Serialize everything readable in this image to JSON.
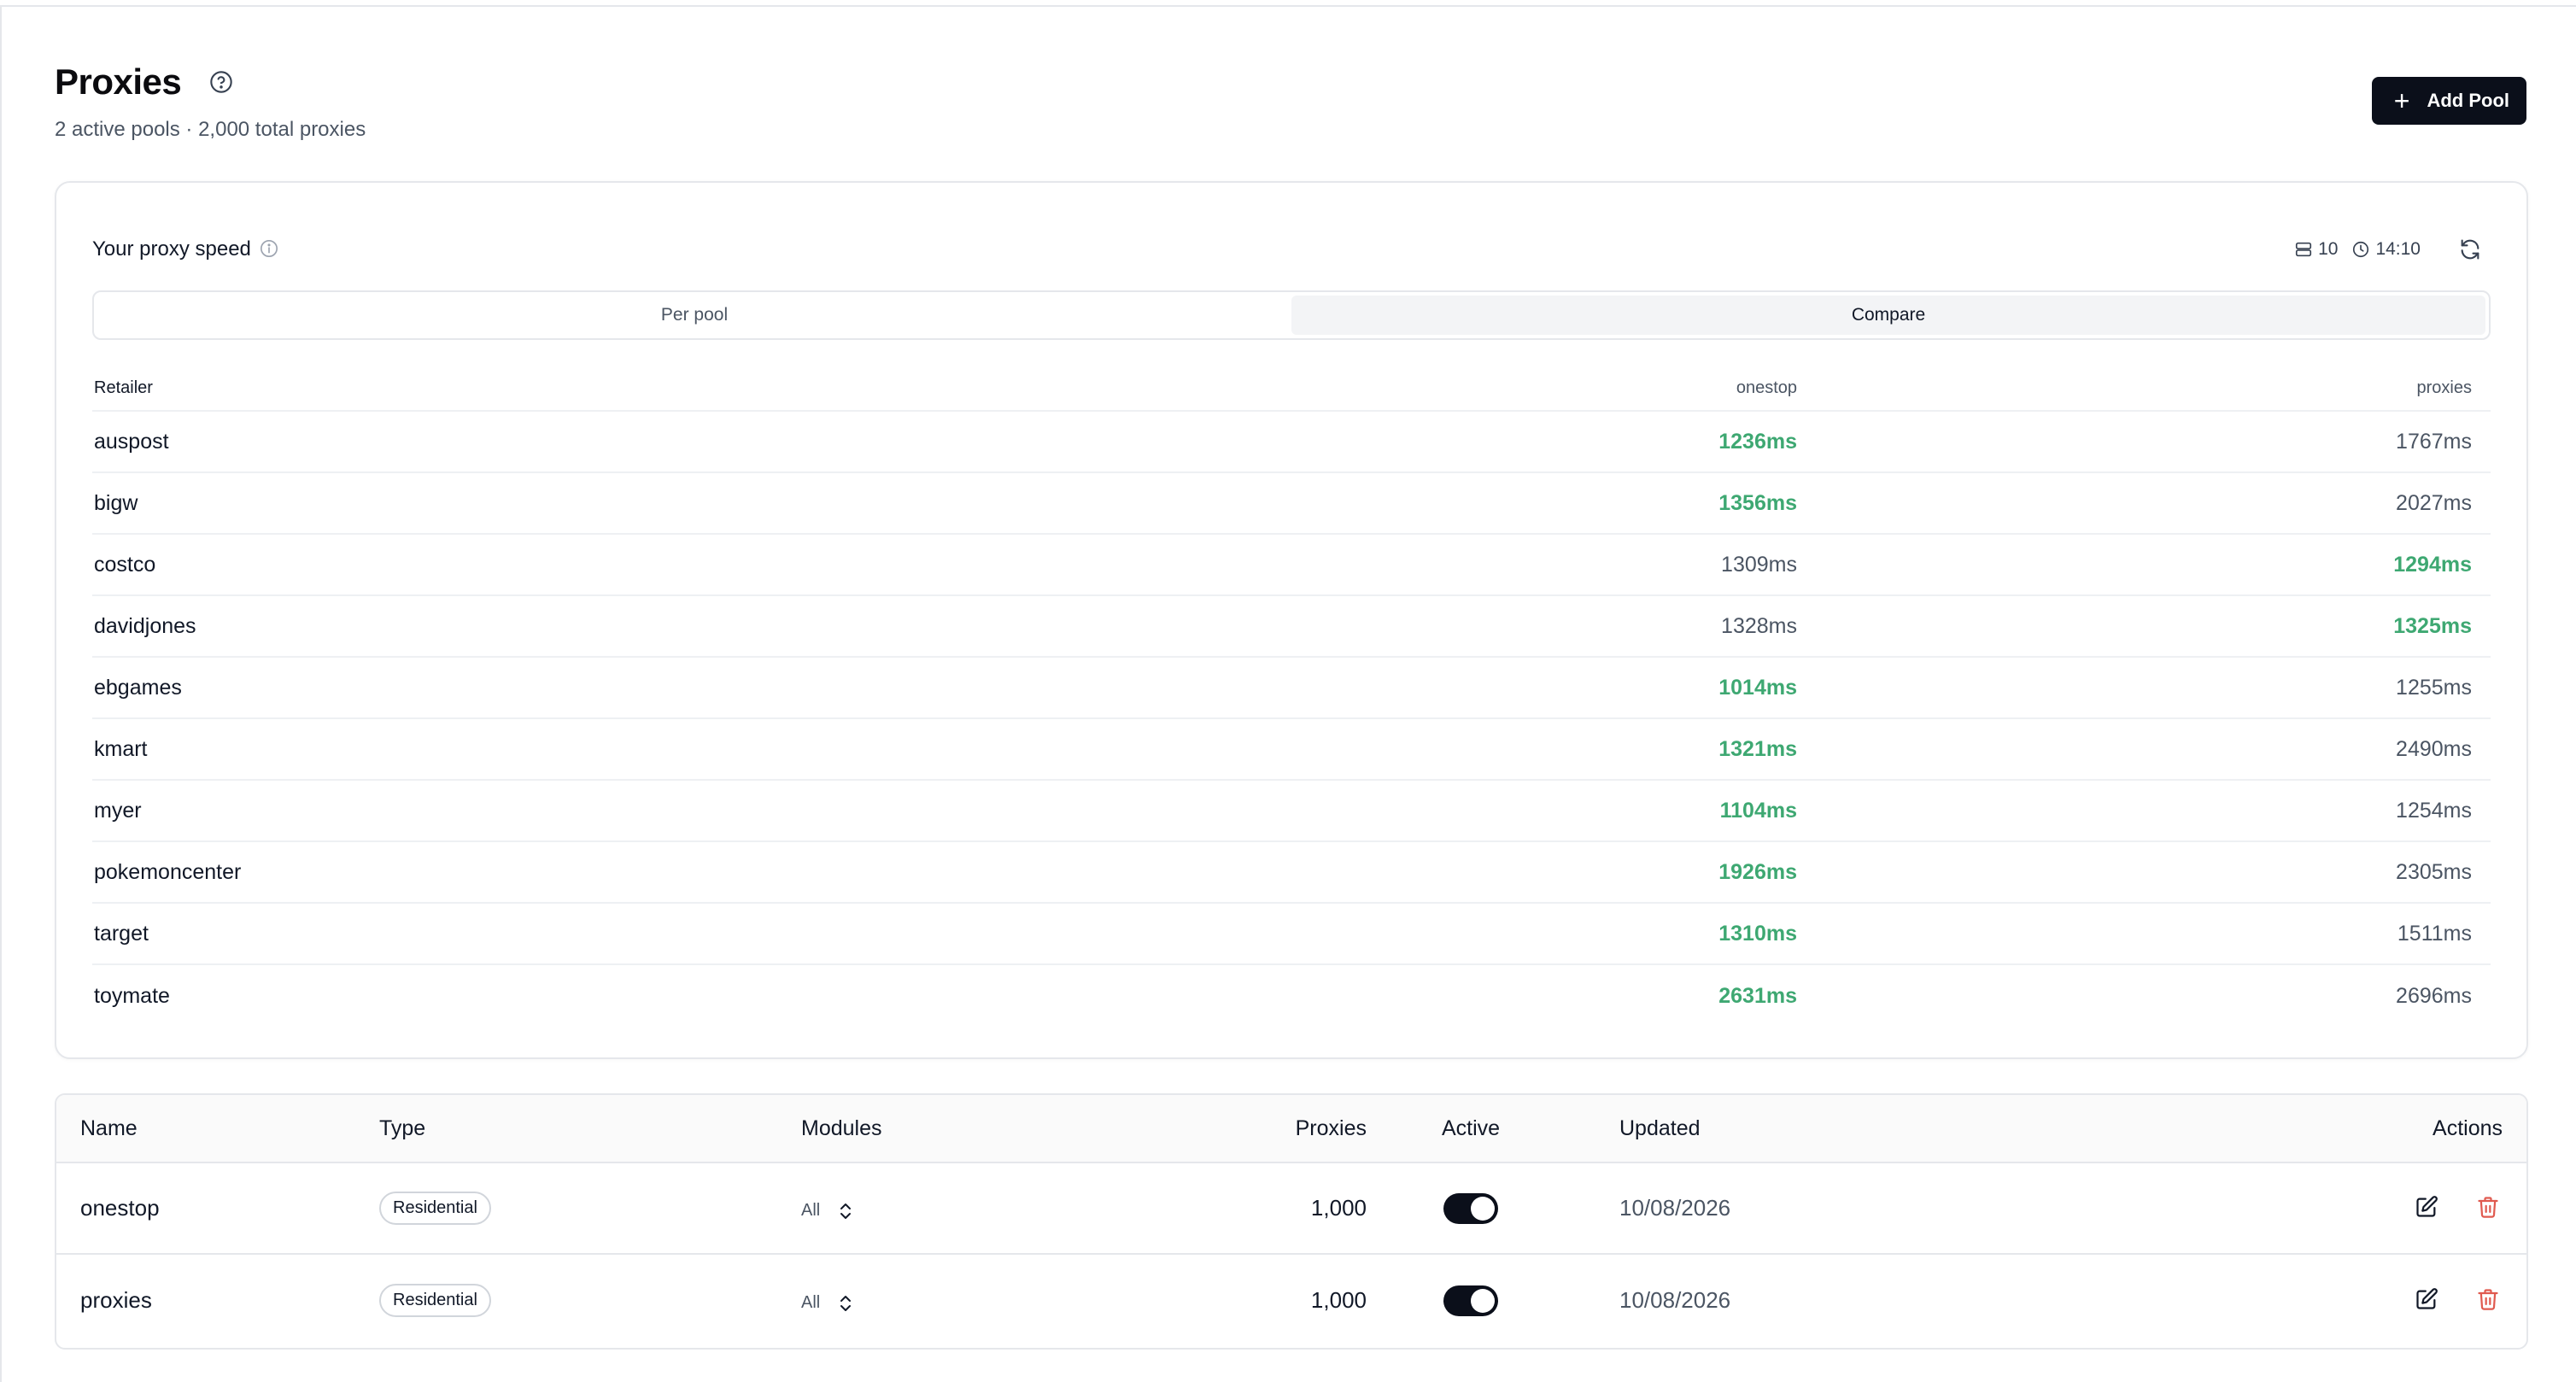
{
  "header": {
    "title": "Proxies",
    "subtitle": "2 active pools · 2,000 total proxies",
    "add_button_label": "Add Pool"
  },
  "speed": {
    "title": "Your proxy speed",
    "meta_count": "10",
    "meta_time": "14:10",
    "tabs": [
      {
        "label": "Per pool",
        "active": false
      },
      {
        "label": "Compare",
        "active": true
      }
    ],
    "columns": [
      "Retailer",
      "onestop",
      "proxies"
    ],
    "rows": [
      {
        "retailer": "auspost",
        "onestop": "1236ms",
        "proxies": "1767ms",
        "best": "onestop"
      },
      {
        "retailer": "bigw",
        "onestop": "1356ms",
        "proxies": "2027ms",
        "best": "onestop"
      },
      {
        "retailer": "costco",
        "onestop": "1309ms",
        "proxies": "1294ms",
        "best": "proxies"
      },
      {
        "retailer": "davidjones",
        "onestop": "1328ms",
        "proxies": "1325ms",
        "best": "proxies"
      },
      {
        "retailer": "ebgames",
        "onestop": "1014ms",
        "proxies": "1255ms",
        "best": "onestop"
      },
      {
        "retailer": "kmart",
        "onestop": "1321ms",
        "proxies": "2490ms",
        "best": "onestop"
      },
      {
        "retailer": "myer",
        "onestop": "1104ms",
        "proxies": "1254ms",
        "best": "onestop"
      },
      {
        "retailer": "pokemoncenter",
        "onestop": "1926ms",
        "proxies": "2305ms",
        "best": "onestop"
      },
      {
        "retailer": "target",
        "onestop": "1310ms",
        "proxies": "1511ms",
        "best": "onestop"
      },
      {
        "retailer": "toymate",
        "onestop": "2631ms",
        "proxies": "2696ms",
        "best": "onestop"
      }
    ],
    "best_color": "#3ea872"
  },
  "pools": {
    "columns": {
      "name": "Name",
      "type": "Type",
      "modules": "Modules",
      "proxies": "Proxies",
      "active": "Active",
      "updated": "Updated",
      "actions": "Actions"
    },
    "rows": [
      {
        "name": "onestop",
        "type": "Residential",
        "modules": "All",
        "proxies": "1,000",
        "active": true,
        "updated": "10/08/2026"
      },
      {
        "name": "proxies",
        "type": "Residential",
        "modules": "All",
        "proxies": "1,000",
        "active": true,
        "updated": "10/08/2026"
      }
    ]
  },
  "icons": {
    "help": "help-circle-icon",
    "info": "info-icon",
    "server": "server-icon",
    "clock": "clock-icon",
    "refresh": "refresh-icon",
    "plus": "plus-icon",
    "chevrons": "chevrons-up-down-icon",
    "edit": "edit-icon",
    "delete": "trash-icon"
  },
  "colors": {
    "primary": "#0b0f1a",
    "danger": "#e05a4f"
  }
}
